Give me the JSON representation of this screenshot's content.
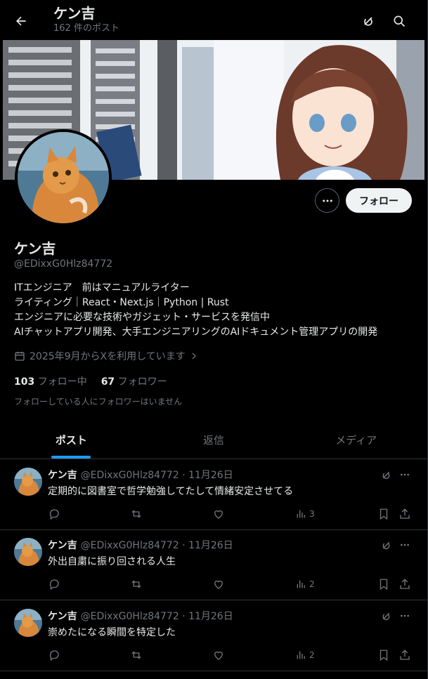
{
  "header": {
    "title": "ケン吉",
    "subtitle": "162 件のポスト",
    "icons": [
      "back-arrow-icon",
      "grok-icon",
      "search-icon"
    ]
  },
  "profile": {
    "name": "ケン吉",
    "handle": "@EDixxG0Hlz84772",
    "follow_label": "フォロー",
    "bio_lines": [
      "ITエンジニア　前はマニュアルライター",
      "ライティング｜React・Next.js｜Python | Rust",
      "エンジニアに必要な技術やガジェット・サービスを発信中",
      "AIチャットアプリ開発、大手エンジニアリングのAIドキュメント管理アプリの開発"
    ],
    "joined": "2025年9月からXを利用しています",
    "following_count": "103",
    "following_label": "フォロー中",
    "followers_count": "67",
    "followers_label": "フォロワー",
    "followers_notice": "フォローしている人にフォロワーはいません"
  },
  "tabs": [
    {
      "label": "ポスト",
      "active": true
    },
    {
      "label": "返信",
      "active": false
    },
    {
      "label": "メディア",
      "active": false
    }
  ],
  "tweets": [
    {
      "name": "ケン吉",
      "meta": "@EDixxG0Hlz84772 · 11月26日",
      "text": "定期的に図書室で哲学勉強してたして情緒安定させてる",
      "views": "3"
    },
    {
      "name": "ケン吉",
      "meta": "@EDixxG0Hlz84772 · 11月26日",
      "text": "外出自粛に振り回される人生",
      "views": "2"
    },
    {
      "name": "ケン吉",
      "meta": "@EDixxG0Hlz84772 · 11月26日",
      "text": "崇めたになる瞬間を特定した",
      "views": "2"
    }
  ],
  "colors": {
    "accent": "#1d9bf0",
    "background": "#000000",
    "muted": "#71767b"
  }
}
